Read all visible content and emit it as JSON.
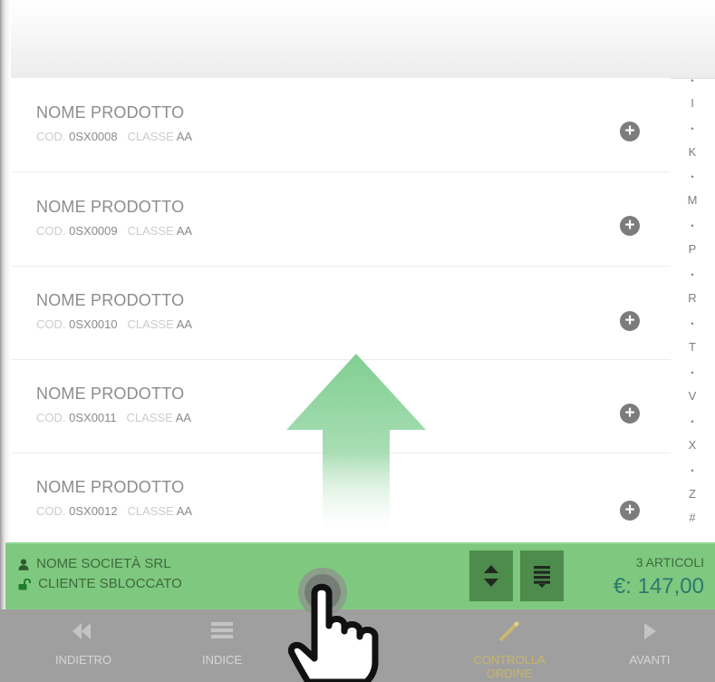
{
  "products": [
    {
      "name": "NOME PRODOTTO",
      "code_label": "COD.",
      "code": "0SX0008",
      "class_label": "CLASSE",
      "class": "AA"
    },
    {
      "name": "NOME PRODOTTO",
      "code_label": "COD.",
      "code": "0SX0009",
      "class_label": "CLASSE",
      "class": "AA"
    },
    {
      "name": "NOME PRODOTTO",
      "code_label": "COD.",
      "code": "0SX0010",
      "class_label": "CLASSE",
      "class": "AA"
    },
    {
      "name": "NOME PRODOTTO",
      "code_label": "COD.",
      "code": "0SX0011",
      "class_label": "CLASSE",
      "class": "AA"
    },
    {
      "name": "NOME PRODOTTO",
      "code_label": "COD.",
      "code": "0SX0012",
      "class_label": "CLASSE",
      "class": "AA"
    }
  ],
  "alpha_index": [
    "•",
    "I",
    "•",
    "K",
    "•",
    "M",
    "•",
    "P",
    "•",
    "R",
    "•",
    "T",
    "•",
    "V",
    "•",
    "X",
    "•",
    "Z",
    "#"
  ],
  "status": {
    "company": "NOME SOCIETÀ SRL",
    "client_status": "CLIENTE SBLOCCATO",
    "articles": "3 ARTICOLI",
    "total": "€: 147,00"
  },
  "nav": {
    "back": "INDIETRO",
    "index": "INDICE",
    "check_order": "CONTROLLA ORDINE",
    "next": "AVANTI"
  },
  "icons": {
    "add": "plus-circle-icon",
    "company": "user-icon",
    "client": "unlock-icon",
    "sort": "sort-icon",
    "list": "list-icon",
    "back": "rewind-icon",
    "index": "menu-icon",
    "check_order": "wand-icon",
    "next": "play-icon"
  },
  "colors": {
    "status_bar": "#7fc87f",
    "total": "#2b7a6e",
    "nav_bar": "#9f9f9f",
    "tool_button": "#4d8c4d"
  }
}
